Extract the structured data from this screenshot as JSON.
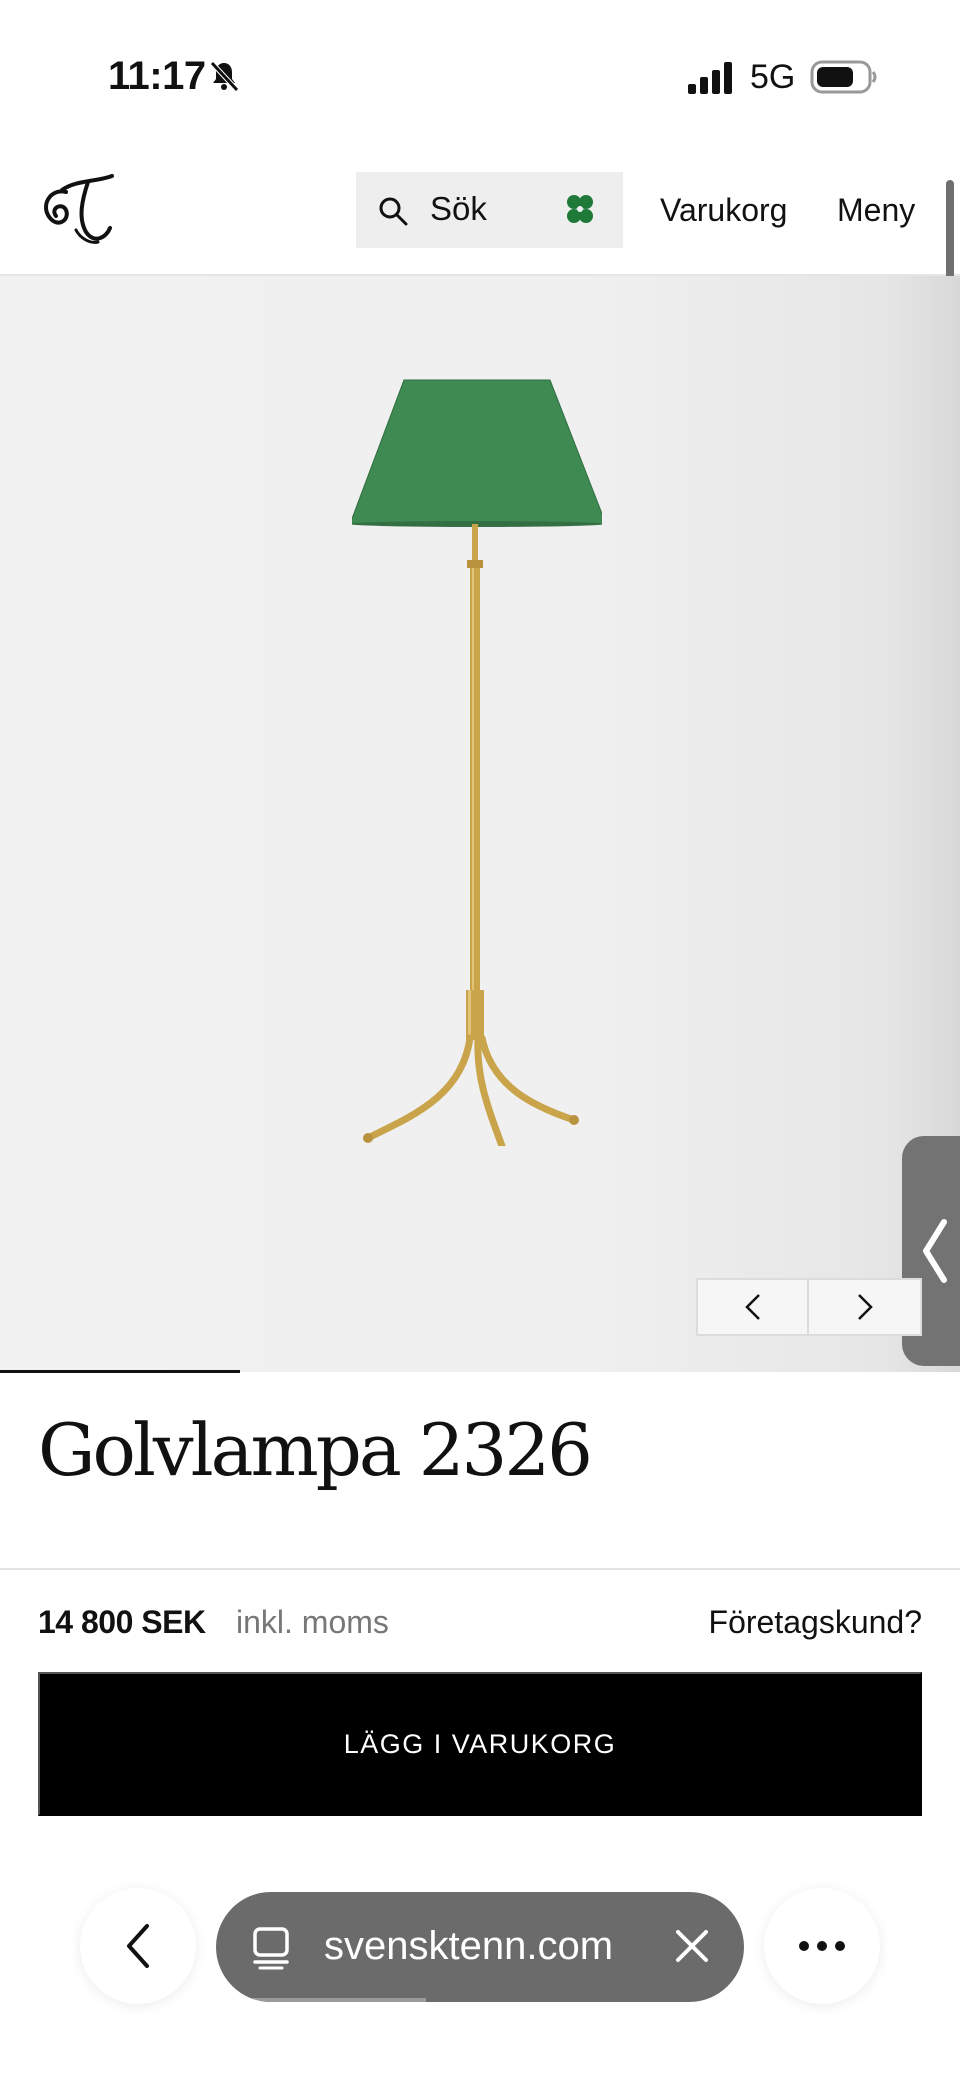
{
  "status_bar": {
    "time": "11:17",
    "network": "5G"
  },
  "header": {
    "logo_name": "svenskt-tenn-logo",
    "search_label": "Sök",
    "cart_label": "Varukorg",
    "menu_label": "Meny",
    "accent_color": "#1f7a3a"
  },
  "gallery": {
    "image_alt": "Golvlampa 2326",
    "shade_color": "#3f8a52",
    "brass_color": "#c9a44a",
    "progress": 0.25
  },
  "product": {
    "title": "Golvlampa 2326",
    "price": "14 800 SEK",
    "price_note": "inkl. moms",
    "business_link": "Företagskund?",
    "add_to_cart_label": "LÄGG I VARUKORG"
  },
  "browser": {
    "url": "svensktenn.com"
  }
}
